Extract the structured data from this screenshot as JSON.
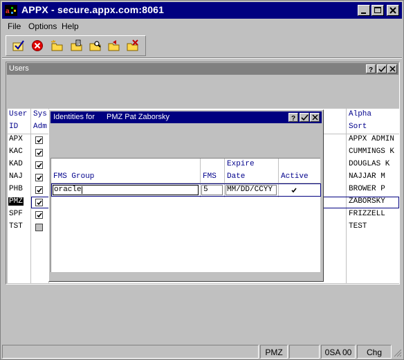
{
  "window": {
    "title": "APPX - secure.appx.com:8061"
  },
  "menu": {
    "items": [
      "File",
      "Options",
      "Help"
    ]
  },
  "toolbar": {
    "icons": [
      "checkmark-icon",
      "cancel-icon",
      "new-folder-icon",
      "edit-folder-icon",
      "search-folder-icon",
      "prev-folder-icon",
      "delete-folder-icon"
    ]
  },
  "users_window": {
    "title": "Users",
    "headers": {
      "user_id_line1": "User",
      "user_id_line2": "ID",
      "sys_line1": "Sys",
      "sys_line2": "Adm",
      "alpha_line1": "Alpha",
      "alpha_line2": "Sort"
    },
    "rows": [
      {
        "id": "APX",
        "sys_admin": true,
        "alpha": "APPX ADMIN"
      },
      {
        "id": "KAC",
        "sys_admin": true,
        "alpha": "CUMMINGS K"
      },
      {
        "id": "KAD",
        "sys_admin": true,
        "alpha": "DOUGLAS K"
      },
      {
        "id": "NAJ",
        "sys_admin": true,
        "alpha": "NAJJAR M"
      },
      {
        "id": "PHB",
        "sys_admin": true,
        "alpha": "BROWER P"
      },
      {
        "id": "PMZ",
        "sys_admin": true,
        "alpha": "ZABORSKY",
        "selected": true
      },
      {
        "id": "SPF",
        "sys_admin": true,
        "alpha": "FRIZZELL"
      },
      {
        "id": "TST",
        "sys_admin": false,
        "alpha": "TEST"
      }
    ]
  },
  "identities_dialog": {
    "title_prefix": "Identities for",
    "title_user": "PMZ Pat Zaborsky",
    "headers": {
      "fms_group": "FMS Group",
      "fms": "FMS",
      "expire_line1": "Expire",
      "expire_line2": "Date",
      "active": "Active"
    },
    "row": {
      "fms_group_value": "oracle",
      "fms_value": "5",
      "expire_value": "MM/DD/CCYY",
      "active": true
    }
  },
  "statusbar": {
    "user": "PMZ",
    "app": "0SA 00",
    "mode": "Chg"
  },
  "colors": {
    "title_active": "#000080",
    "title_inactive": "#808080",
    "header_text": "#00008b",
    "face": "#c0c0c0"
  }
}
